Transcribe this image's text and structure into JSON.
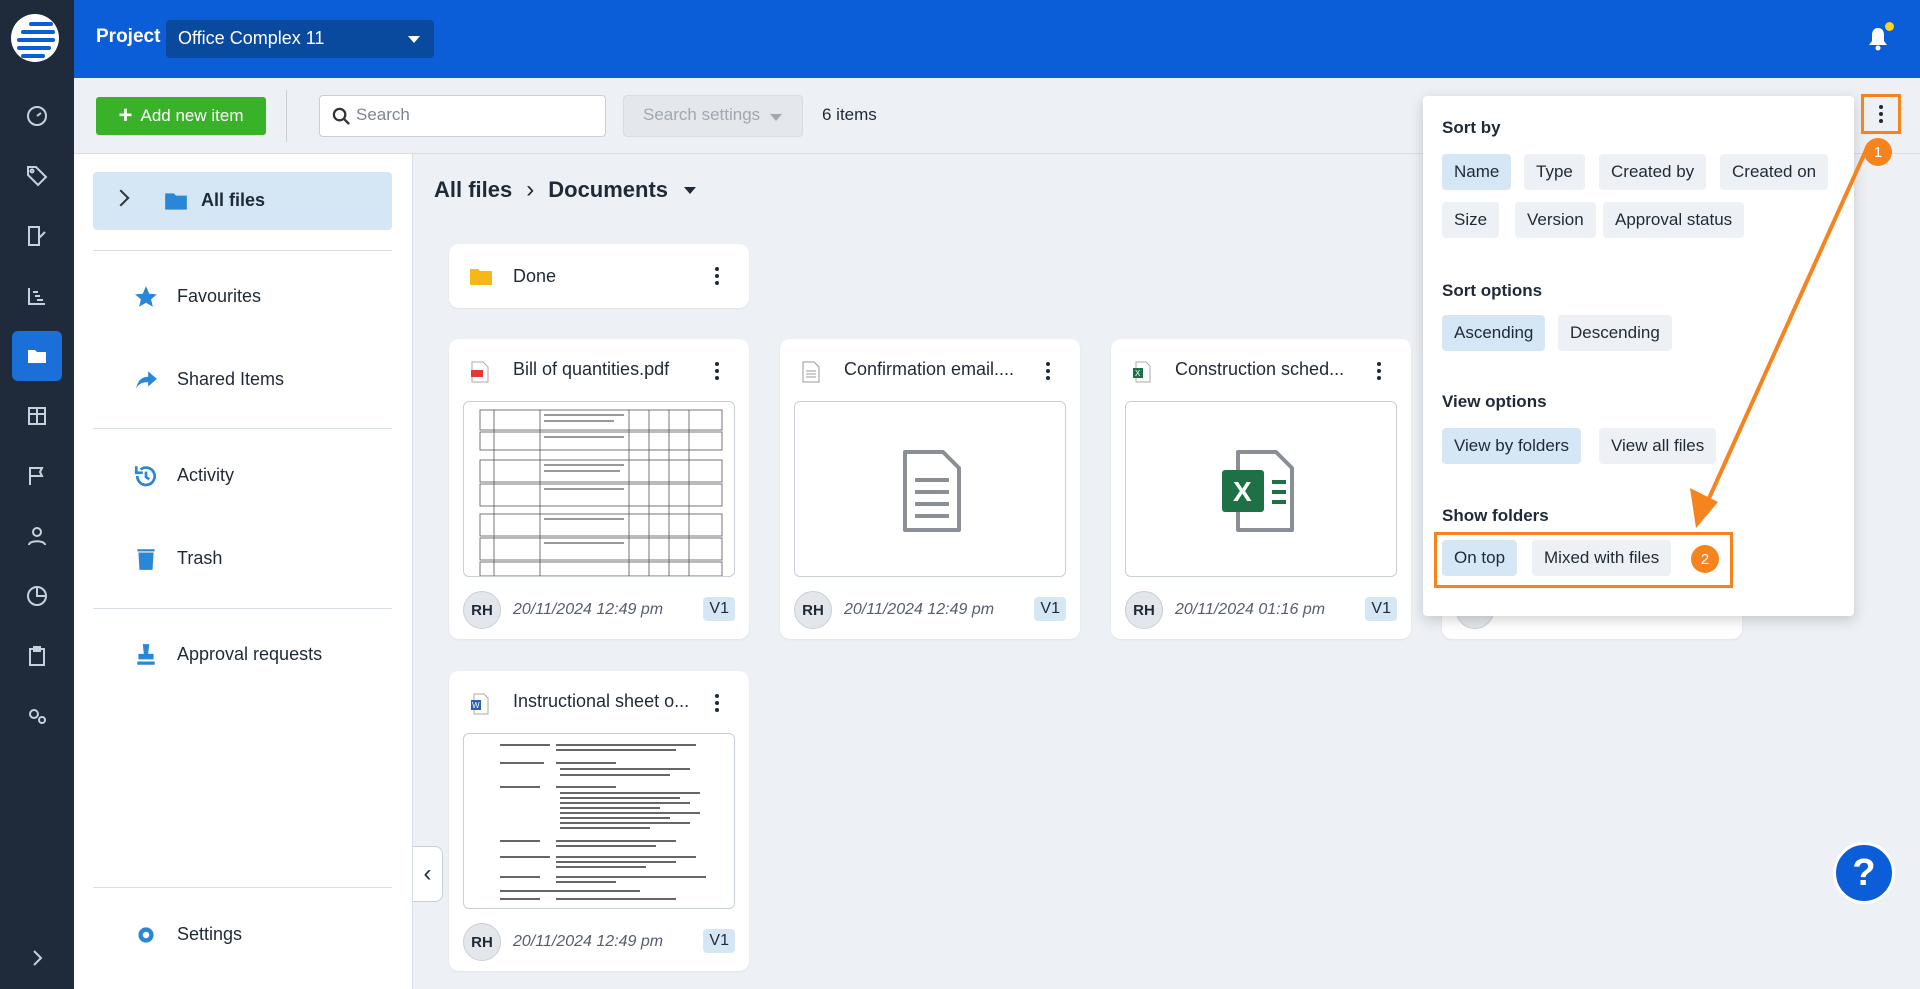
{
  "topbar": {
    "project_label": "Project",
    "project_name": "Office Complex 11"
  },
  "toolbar": {
    "add_label": "Add new item",
    "search_placeholder": "Search",
    "search_settings": "Search settings",
    "items_count": "6 items"
  },
  "sidenav": {
    "all_files": "All files",
    "items": [
      "Favourites",
      "Shared Items",
      "Activity",
      "Trash",
      "Approval requests"
    ],
    "settings": "Settings"
  },
  "breadcrumb": {
    "root": "All files",
    "current": "Documents"
  },
  "folder": {
    "name": "Done"
  },
  "files": [
    {
      "name": "Bill of quantities.pdf",
      "type": "pdf",
      "author": "RH",
      "date": "20/11/2024 12:49 pm",
      "version": "V1"
    },
    {
      "name": "Confirmation email....",
      "type": "doc",
      "author": "RH",
      "date": "20/11/2024 12:49 pm",
      "version": "V1"
    },
    {
      "name": "Construction sched...",
      "type": "excel",
      "author": "RH",
      "date": "20/11/2024 01:16 pm",
      "version": "V1"
    },
    {
      "name": "Instructional sheet o...",
      "type": "word",
      "author": "RH",
      "date": "20/11/2024 12:49 pm",
      "version": "V1"
    }
  ],
  "menu": {
    "sort_by_title": "Sort by",
    "sort_by": [
      "Name",
      "Type",
      "Created by",
      "Created on",
      "Size",
      "Version",
      "Approval status"
    ],
    "sort_options_title": "Sort options",
    "sort_options": [
      "Ascending",
      "Descending"
    ],
    "view_options_title": "View options",
    "view_options": [
      "View by folders",
      "View all files"
    ],
    "show_folders_title": "Show folders",
    "show_folders": [
      "On top",
      "Mixed with files"
    ]
  },
  "annotations": {
    "badge1": "1",
    "badge2": "2"
  },
  "help": {
    "label": "?"
  },
  "colors": {
    "brand": "#0b5ed7",
    "accent_add": "#39b22a",
    "highlight": "#f5841f",
    "selected_chip": "#d5e6f5"
  }
}
